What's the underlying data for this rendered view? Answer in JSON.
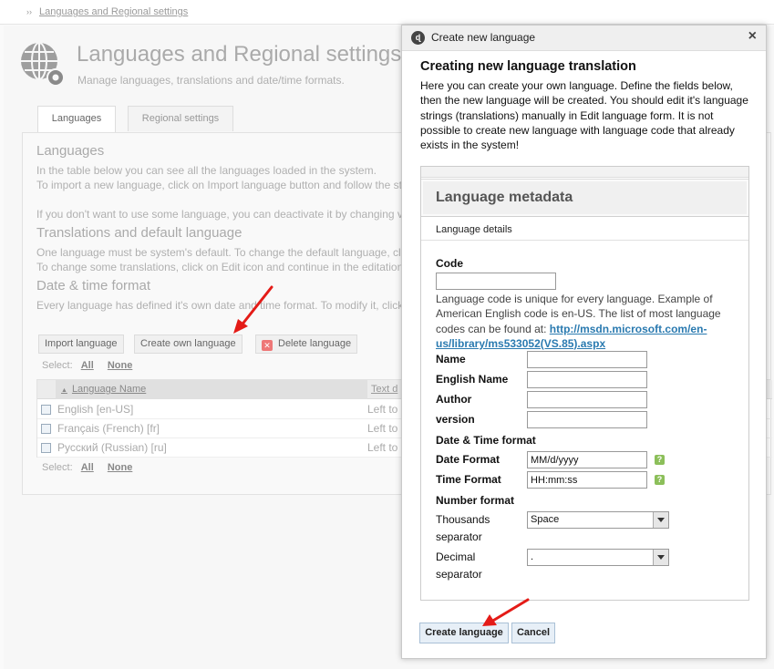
{
  "breadcrumb": {
    "separator": "››",
    "link": "Languages and Regional settings"
  },
  "page": {
    "title": "Languages and Regional settings",
    "subtitle": "Manage languages, translations and date/time formats."
  },
  "tabs": [
    {
      "label": "Languages",
      "active": true
    },
    {
      "label": "Regional settings",
      "active": false
    }
  ],
  "sections": {
    "languages_heading": "Languages",
    "languages_text1": "In the table below you can see all the languages loaded in the system.",
    "languages_text2": "To import a new language, click on Import language button and follow the st",
    "languages_text3": "If you don't want to use some language, you can deactivate it by changing v",
    "translations_heading": "Translations and default language",
    "translations_text1": "One language must be system's default. To change the default language, cl",
    "translations_text2": "To change some translations, click on Edit icon and continue in the editation",
    "datetime_heading": "Date & time format",
    "datetime_text1": "Every language has defined it's own date and time format. To modify it, click"
  },
  "toolbar": {
    "import_label": "Import language",
    "create_label": "Create own language",
    "delete_label": "Delete language"
  },
  "select": {
    "label": "Select:",
    "all": "All",
    "none": "None"
  },
  "table": {
    "columns": [
      "Language Name",
      "Text d"
    ],
    "rows": [
      {
        "name": "English [en-US]",
        "text": "Left to"
      },
      {
        "name": "Français (French) [fr]",
        "text": "Left to"
      },
      {
        "name": "Русский (Russian) [ru]",
        "text": "Left to"
      }
    ]
  },
  "dialog": {
    "title": "Create new language",
    "close": "×",
    "heading": "Creating new language translation",
    "intro": "Here you can create your own language. Define the fields below, then the new language will be created. You should edit it's language strings (translations) manually in Edit language form. It is not possible to create new language with language code that already exists in the system!",
    "metadata_heading": "Language metadata",
    "details_label": "Language details",
    "code_label": "Code",
    "code_value": "",
    "code_hint": "Language code is unique for every language. Example of American English code is en-US. The list of most language codes can be found at: ",
    "code_hint_url": "http://msdn.microsoft.com/en-us/library/ms533052(VS.85).aspx",
    "name_label": "Name",
    "english_name_label": "English Name",
    "author_label": "Author",
    "version_label": "version",
    "datetime_heading": "Date & Time format",
    "date_format_label": "Date Format",
    "date_format_value": "MM/d/yyyy",
    "time_format_label": "Time Format",
    "time_format_value": "HH:mm:ss",
    "number_heading": "Number format",
    "thousands_label1": "Thousands",
    "thousands_label2": "separator",
    "thousands_value": "Space",
    "decimal_label1": "Decimal",
    "decimal_label2": "separator",
    "decimal_value": ".",
    "help_glyph": "?",
    "create_button": "Create language",
    "cancel_button": "Cancel"
  },
  "colors": {
    "arrow": "#e41b17",
    "link": "#2a7ab0",
    "help": "#8cbf5a"
  }
}
